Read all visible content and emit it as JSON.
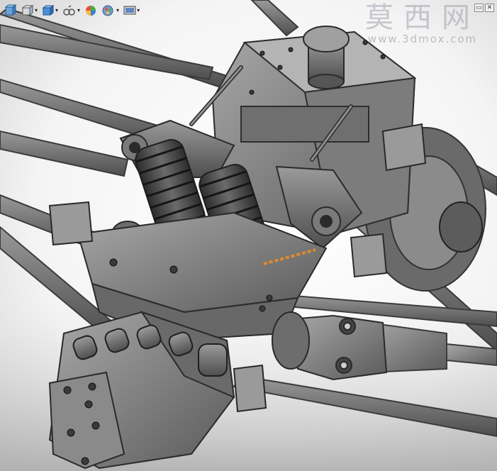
{
  "viewport": {
    "name": "3D model view"
  },
  "toolbar": {
    "items": [
      {
        "icon": "view-orientation-icon"
      },
      {
        "icon": "display-style-icon"
      },
      {
        "icon": "hide-show-items-icon"
      },
      {
        "icon": "edit-appearance-icon"
      },
      {
        "icon": "apply-scene-icon"
      },
      {
        "icon": "view-settings-icon"
      }
    ]
  },
  "watermark": {
    "title": "莫西网",
    "url": "www.3dmox.com"
  },
  "window_controls": {
    "restore": "▭",
    "close": "✕"
  },
  "colors": {
    "background": "#ffffff",
    "metal": "#7d7d7d",
    "dark_metal": "#3a3a3a",
    "accent": "#e08a2a"
  }
}
